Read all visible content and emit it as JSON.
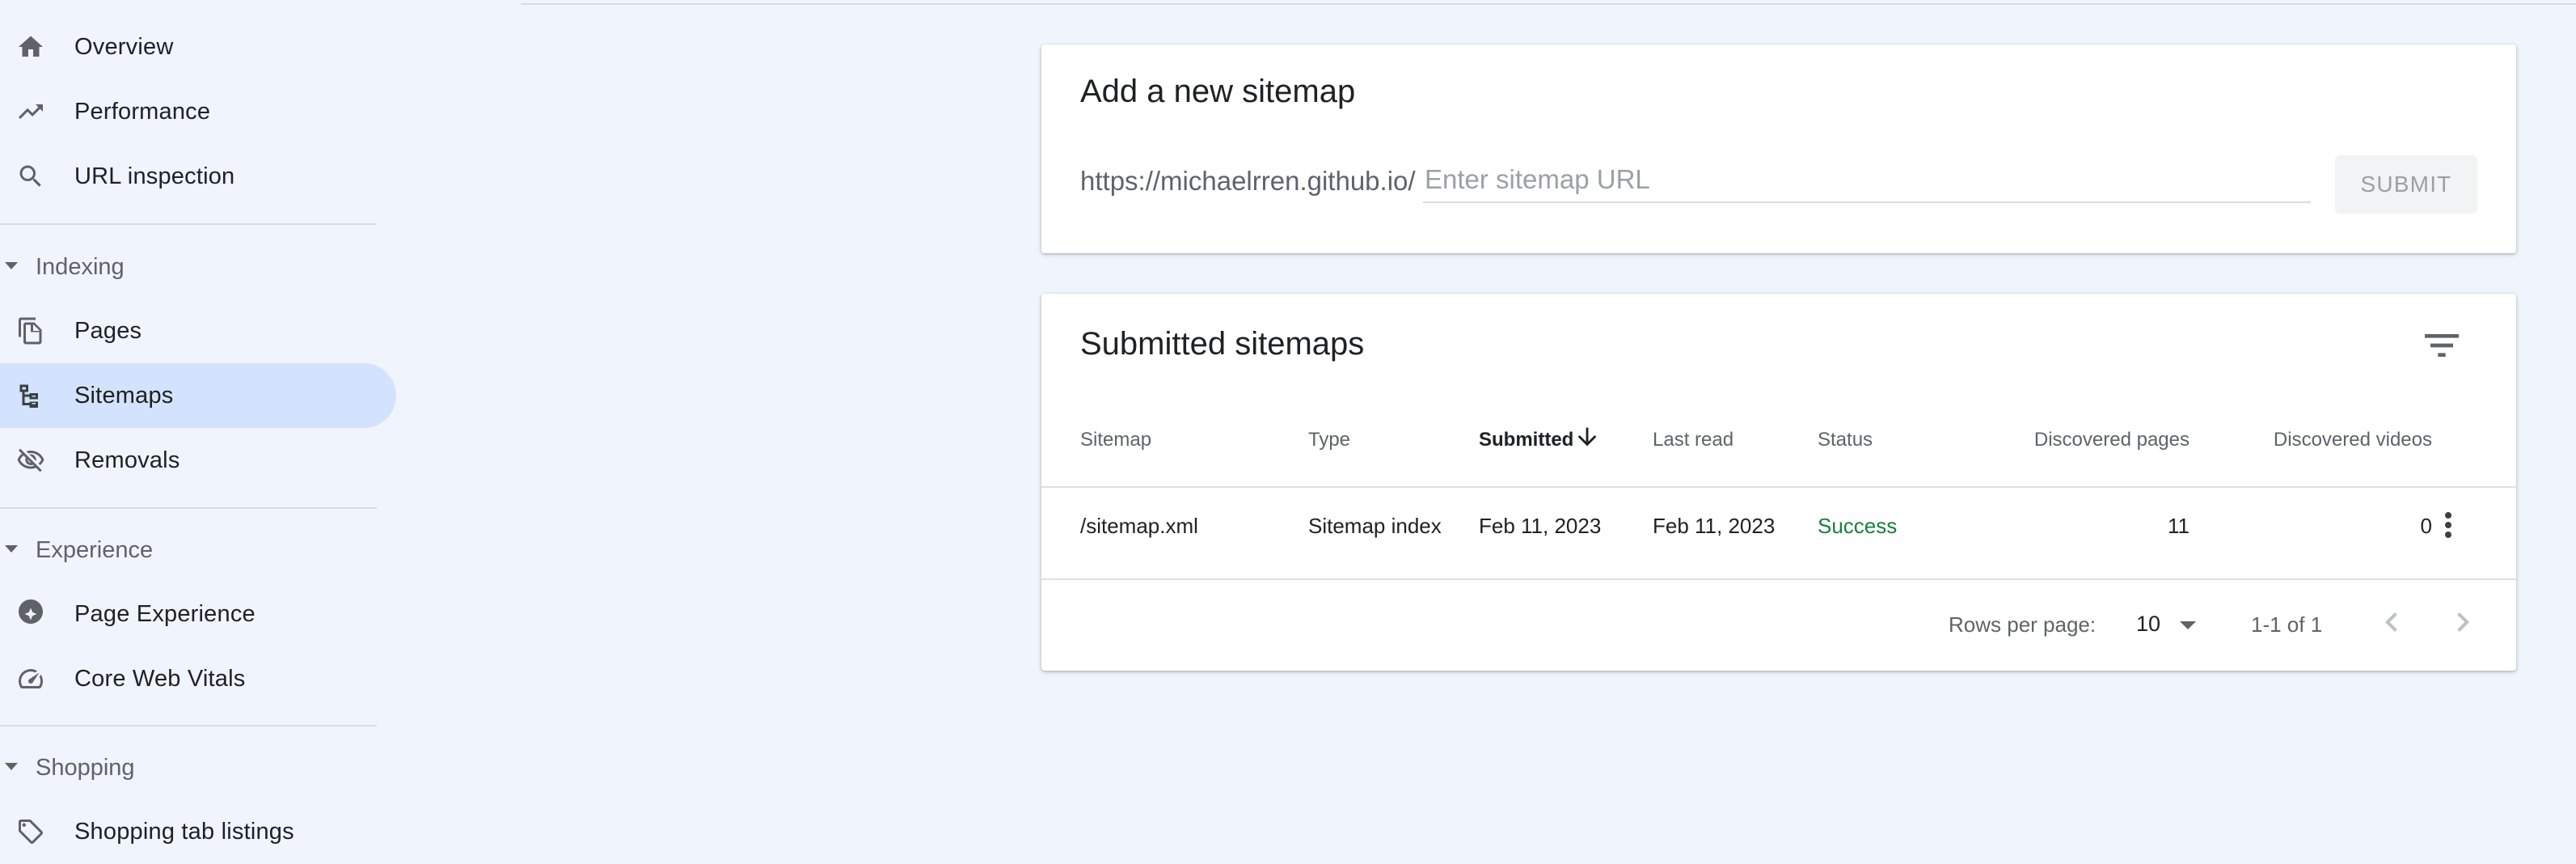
{
  "sidebar": {
    "items": {
      "overview": {
        "label": "Overview",
        "icon": "home-icon"
      },
      "performance": {
        "label": "Performance",
        "icon": "trending-up-icon"
      },
      "url_inspection": {
        "label": "URL inspection",
        "icon": "search-icon"
      },
      "pages": {
        "label": "Pages",
        "icon": "pages-icon"
      },
      "sitemaps": {
        "label": "Sitemaps",
        "icon": "sitemap-icon",
        "active": true
      },
      "removals": {
        "label": "Removals",
        "icon": "eye-off-icon"
      },
      "page_experience": {
        "label": "Page Experience",
        "icon": "experience-icon"
      },
      "core_web_vitals": {
        "label": "Core Web Vitals",
        "icon": "speed-gauge-icon"
      },
      "shopping_tab": {
        "label": "Shopping tab listings",
        "icon": "tag-icon"
      }
    },
    "sections": {
      "indexing": "Indexing",
      "experience": "Experience",
      "shopping": "Shopping"
    }
  },
  "add_sitemap": {
    "title": "Add a new sitemap",
    "prefix": "https://michaelrren.github.io/",
    "input_value": "",
    "placeholder": "Enter sitemap URL",
    "submit_label": "SUBMIT"
  },
  "submitted": {
    "title": "Submitted sitemaps",
    "columns": {
      "sitemap": "Sitemap",
      "type": "Type",
      "submitted": "Submitted",
      "last_read": "Last read",
      "status": "Status",
      "discovered_pages": "Discovered pages",
      "discovered_videos": "Discovered videos"
    },
    "rows": [
      {
        "sitemap": "/sitemap.xml",
        "type": "Sitemap index",
        "submitted": "Feb 11, 2023",
        "last_read": "Feb 11, 2023",
        "status": "Success",
        "discovered_pages": "11",
        "discovered_videos": "0"
      }
    ],
    "pagination": {
      "rows_per_page_label": "Rows per page:",
      "rows_per_page": "10",
      "range": "1-1 of 1"
    }
  },
  "colors": {
    "background": "#f0f4fc",
    "active_nav": "#d3e3fd",
    "success": "#188038"
  }
}
